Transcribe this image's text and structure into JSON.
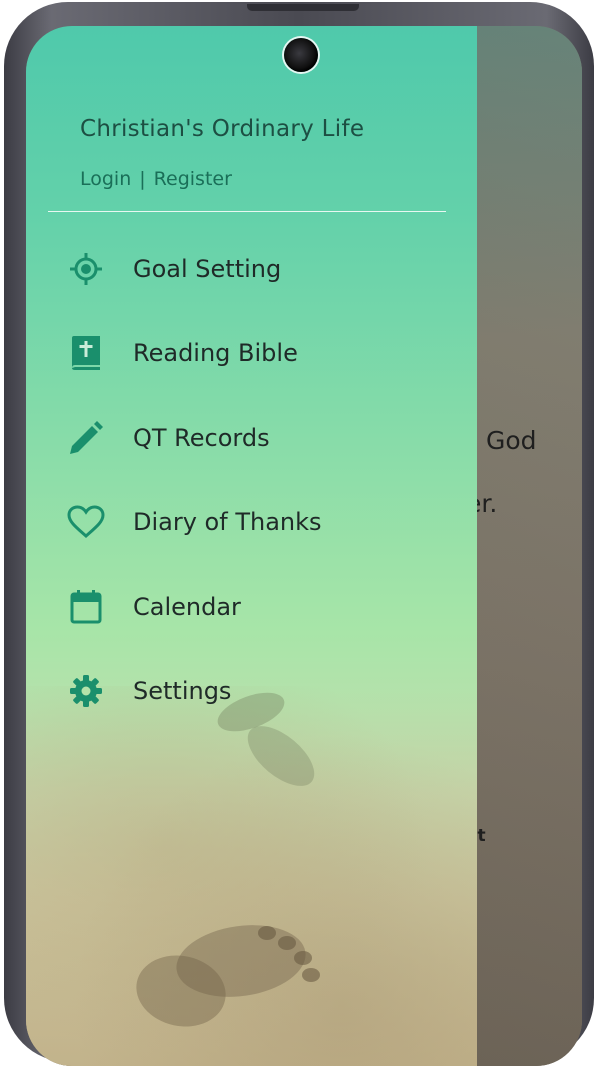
{
  "drawer": {
    "title": "Christian's Ordinary Life",
    "login_label": "Login",
    "separator": "|",
    "register_label": "Register",
    "accent_color": "#1a8f6c",
    "items": [
      {
        "label": "Goal Setting",
        "icon": "target-icon"
      },
      {
        "label": "Reading Bible",
        "icon": "bible-icon"
      },
      {
        "label": "QT Records",
        "icon": "pencil-icon"
      },
      {
        "label": "Diary of Thanks",
        "icon": "heart-icon"
      },
      {
        "label": "Calendar",
        "icon": "calendar-icon"
      },
      {
        "label": "Settings",
        "icon": "gear-icon"
      }
    ]
  },
  "background_app": {
    "text_lines": [
      "God",
      "er.",
      ";",
      "at"
    ]
  }
}
